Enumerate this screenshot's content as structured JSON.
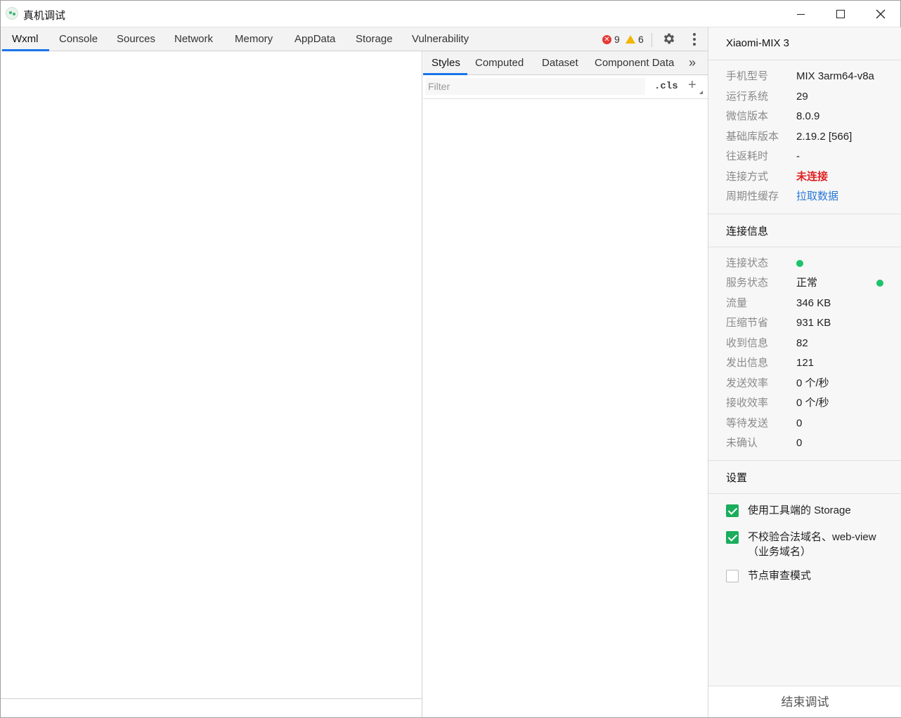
{
  "window": {
    "title": "真机调试"
  },
  "main_tabs": [
    "Wxml",
    "Console",
    "Sources",
    "Network",
    "Memory",
    "AppData",
    "Storage",
    "Vulnerability"
  ],
  "toolbar": {
    "error_count": "9",
    "warning_count": "6",
    "error_icon": "error-icon",
    "warning_icon": "warning-icon"
  },
  "styles_tabs": [
    "Styles",
    "Computed",
    "Dataset",
    "Component Data"
  ],
  "styles": {
    "more_glyph": "»",
    "filter_placeholder": "Filter",
    "cls_label": ".cls",
    "add_label": "+"
  },
  "device": {
    "name": "Xiaomi-MIX 3",
    "info": [
      {
        "label": "手机型号",
        "value": "MIX 3arm64-v8a"
      },
      {
        "label": "运行系统",
        "value": "29"
      },
      {
        "label": "微信版本",
        "value": "8.0.9"
      },
      {
        "label": "基础库版本",
        "value": "2.19.2 [566]"
      },
      {
        "label": "往返耗时",
        "value": "-"
      },
      {
        "label": "连接方式",
        "value": "未连接"
      },
      {
        "label": "周期性缓存",
        "value": "拉取数据"
      }
    ],
    "connection_title": "连接信息",
    "connection": [
      {
        "label": "连接状态",
        "value": ""
      },
      {
        "label": "服务状态",
        "value": "正常"
      },
      {
        "label": "流量",
        "value": "346 KB"
      },
      {
        "label": "压缩节省",
        "value": "931 KB"
      },
      {
        "label": "收到信息",
        "value": "82"
      },
      {
        "label": "发出信息",
        "value": "121"
      },
      {
        "label": "发送效率",
        "value": "0 个/秒"
      },
      {
        "label": "接收效率",
        "value": "0 个/秒"
      },
      {
        "label": "等待发送",
        "value": "0"
      },
      {
        "label": "未确认",
        "value": "0"
      }
    ],
    "settings_title": "设置",
    "settings": [
      {
        "label": "使用工具端的 Storage",
        "checked": true
      },
      {
        "label": "不校验合法域名、web-view（业务域名）",
        "checked": true
      },
      {
        "label": "节点审查模式",
        "checked": false
      }
    ],
    "end_button": "结束调试",
    "status_color": "#1cc36b",
    "accent_color": "#1a73e8"
  }
}
